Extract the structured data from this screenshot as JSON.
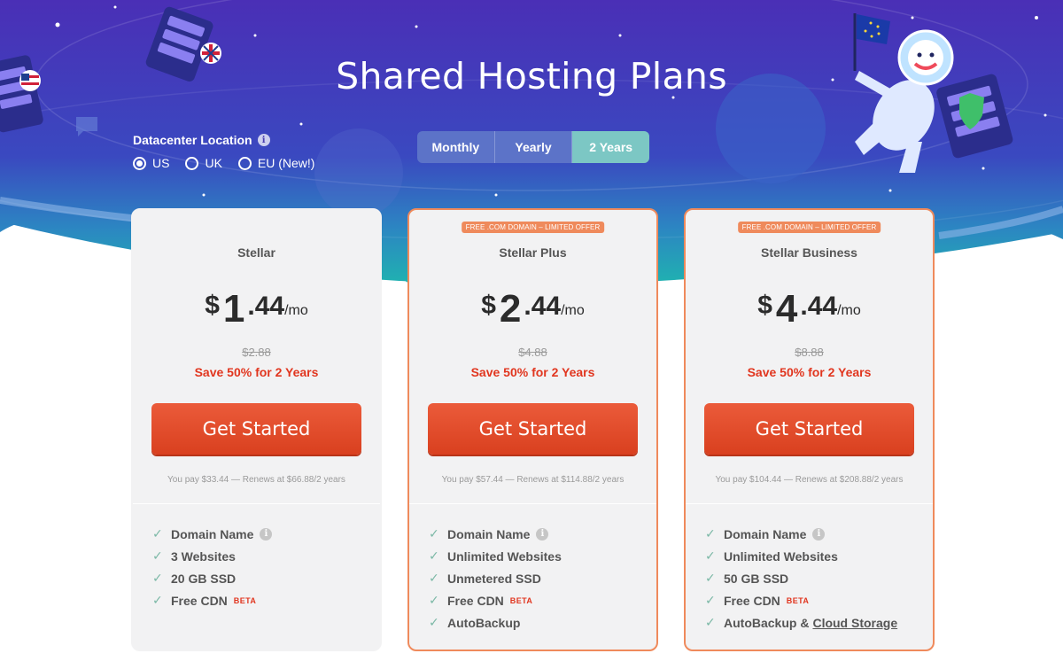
{
  "hero": {
    "title": "Shared Hosting Plans",
    "colors": {
      "top": "#4a2fb6",
      "mid": "#3a55c4",
      "bottom": "#1fb3b0"
    },
    "illustrations": [
      "server-uk-flag-icon",
      "server-us-flag-icon",
      "chat-bubble-icon",
      "planet-icon",
      "yeti-astronaut-with-eu-flag-icon",
      "server-shield-icon"
    ]
  },
  "datacenter": {
    "label": "Datacenter Location",
    "info_icon": "i",
    "options": [
      {
        "label": "US",
        "checked": true
      },
      {
        "label": "UK",
        "checked": false
      },
      {
        "label": "EU (New!)",
        "checked": false
      }
    ]
  },
  "billing": {
    "options": [
      "Monthly",
      "Yearly",
      "2 Years"
    ],
    "active": "2 Years"
  },
  "plans": [
    {
      "badge": "",
      "name": "Stellar",
      "currency": "$",
      "price_int": "1",
      "price_dec": ".44",
      "per": "/mo",
      "old_price": "$2.88",
      "save": "Save 50% for 2 Years",
      "cta": "Get Started",
      "pay_note": "You pay $33.44 — Renews at $66.88/2 years",
      "features": [
        "Domain Name",
        "3 Websites",
        "20 GB SSD",
        "Free CDN"
      ],
      "beta": "BETA"
    },
    {
      "badge": "FREE .COM DOMAIN – LIMITED OFFER",
      "name": "Stellar Plus",
      "currency": "$",
      "price_int": "2",
      "price_dec": ".44",
      "per": "/mo",
      "old_price": "$4.88",
      "save": "Save 50% for 2 Years",
      "cta": "Get Started",
      "pay_note": "You pay $57.44 — Renews at $114.88/2 years",
      "features": [
        "Domain Name",
        "Unlimited Websites",
        "Unmetered SSD",
        "Free CDN",
        "AutoBackup"
      ],
      "beta": "BETA"
    },
    {
      "badge": "FREE .COM DOMAIN – LIMITED OFFER",
      "name": "Stellar Business",
      "currency": "$",
      "price_int": "4",
      "price_dec": ".44",
      "per": "/mo",
      "old_price": "$8.88",
      "save": "Save 50% for 2 Years",
      "cta": "Get Started",
      "pay_note": "You pay $104.44 — Renews at $208.88/2 years",
      "features": [
        "Domain Name",
        "Unlimited Websites",
        "50 GB SSD",
        "Free CDN",
        "AutoBackup &"
      ],
      "feature_link": "Cloud Storage",
      "beta": "BETA"
    }
  ],
  "colors": {
    "cta": "#e04a2a",
    "save_text": "#e1361f",
    "featured_border": "#ef8a5c",
    "check": "#7bb8a6",
    "toggle_active": "#7cc7c4"
  }
}
